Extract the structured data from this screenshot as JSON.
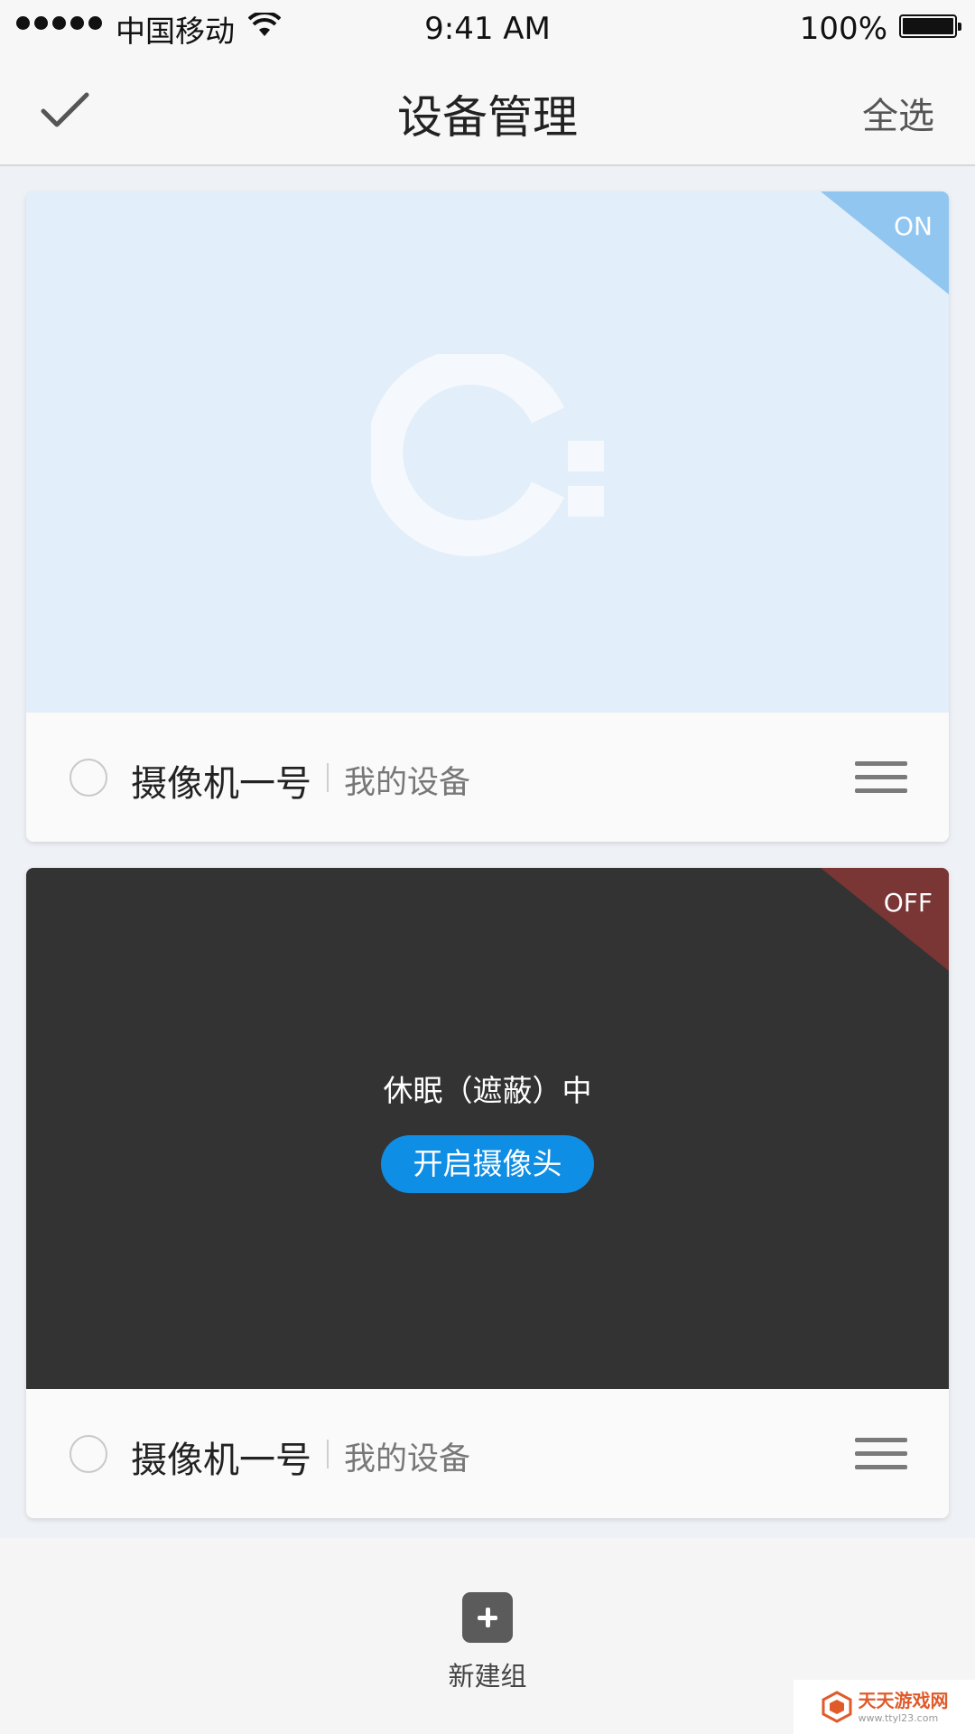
{
  "status_bar": {
    "carrier": "中国移动",
    "time": "9:41 AM",
    "battery": "100%",
    "signal_bars": 5
  },
  "nav": {
    "title": "设备管理",
    "select_all": "全选",
    "confirm_icon": "checkmark-icon"
  },
  "devices": [
    {
      "status": "ON",
      "status_color": "#91c6f0",
      "preview_bg": "#e2eef9",
      "name": "摄像机一号",
      "group": "我的设备"
    },
    {
      "status": "OFF",
      "status_color": "#7a3535",
      "preview_bg": "#333333",
      "sleep_text": "休眠（遮蔽）中",
      "open_button": "开启摄像头",
      "name": "摄像机一号",
      "group": "我的设备"
    }
  ],
  "bottom": {
    "new_group_label": "新建组",
    "new_group_icon": "plus-square-icon"
  },
  "watermark": {
    "title": "天天游戏网",
    "url": "www.ttyl23.com"
  },
  "colors": {
    "accent": "#0f8ee5"
  }
}
